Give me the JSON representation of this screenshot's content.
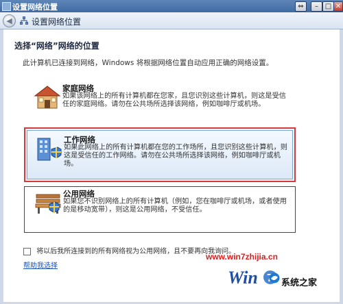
{
  "window": {
    "title": "设置网络位置",
    "buttons": {
      "resize": "⇔",
      "minimize": "–",
      "maximize": "□",
      "close": "✕"
    }
  },
  "nav": {
    "back_icon": "back-arrow-icon",
    "title": "设置网络位置"
  },
  "page": {
    "heading": "选择“网络”网络的位置",
    "intro": "此计算机已连接到网络，Windows 将根据网络位置自动应用正确的网络设置。"
  },
  "options": [
    {
      "id": "home",
      "icon": "house-icon",
      "title": "家庭网络",
      "desc": "如果该网络上的所有计算机都在您家，且您识别这些计算机，则这是受信任的家庭网络。请勿在公共场所选择该网络，例如咖啡厅或机场。",
      "selected": false
    },
    {
      "id": "work",
      "icon": "office-building-icon",
      "title": "工作网络",
      "desc": "如果此网络上的所有计算机都在您的工作场所，且您识别这些计算机，则这是受信任的工作网络。请勿在公共场所选择该网络，例如咖啡厅或机场。",
      "selected": true
    },
    {
      "id": "public",
      "icon": "park-bench-icon",
      "title": "公用网络",
      "desc": "如果您不识别网络上的所有计算机（例如，您在咖啡厅或机场，或者使用的是移动宽带），则这是公用网络，不受信任。",
      "selected": false
    }
  ],
  "checkbox": {
    "label": "将以后我所连接到的所有网络视为公用网络，且不要再向我询问。",
    "checked": false
  },
  "help_link": "帮助我选择",
  "watermark": {
    "url": "www.win7zhijia.cn",
    "site_name": "系统之家"
  },
  "colors": {
    "title_bar": "#3f6aa3",
    "selection_border": "#d43a3a",
    "link": "#1b52b8",
    "watermark_red": "#e11b1b"
  }
}
